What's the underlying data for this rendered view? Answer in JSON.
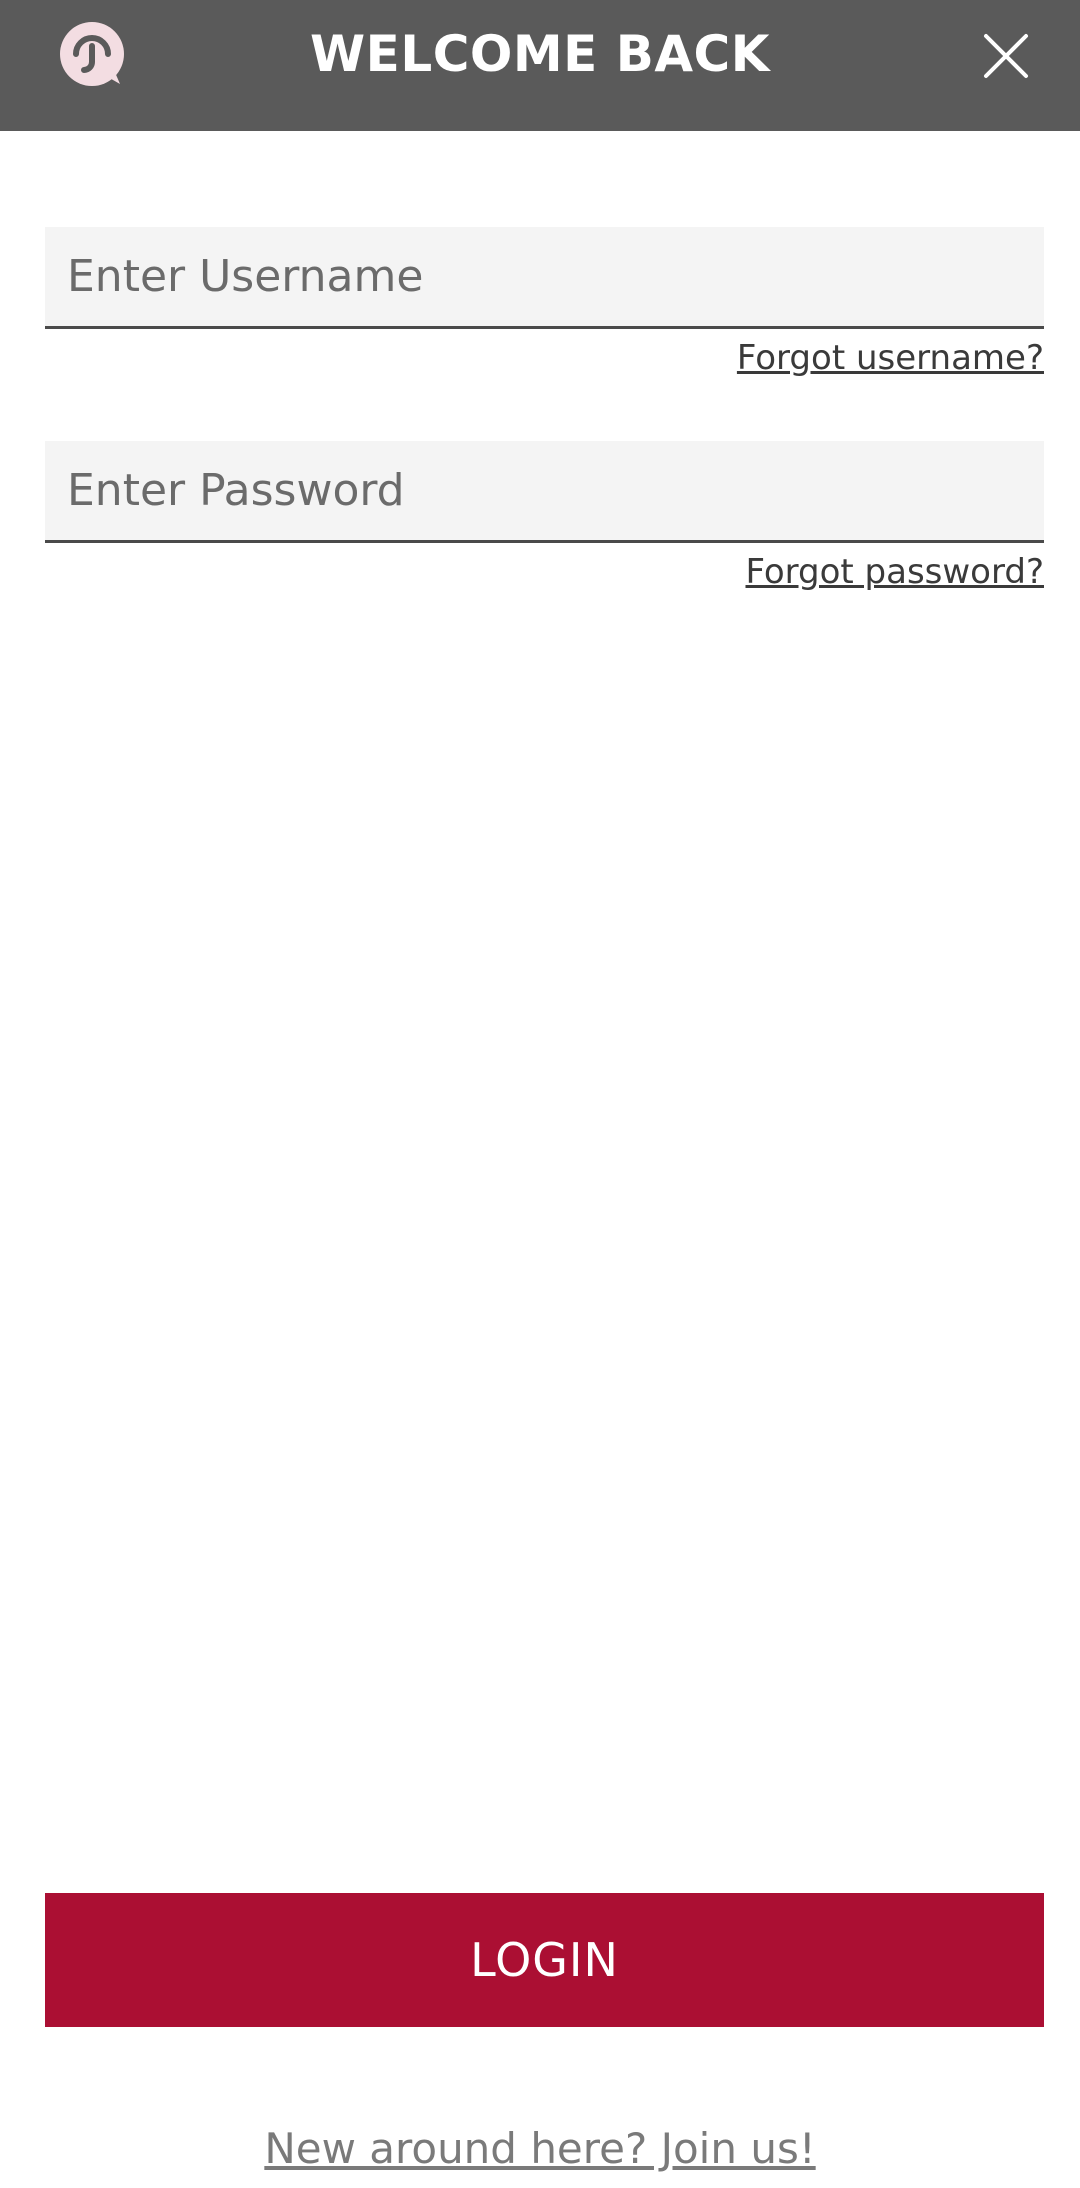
{
  "header": {
    "title": "WELCOME BACK",
    "logo_icon": "chat-bubble-logo-icon",
    "close_icon": "close-icon",
    "background": "#5a5a5a"
  },
  "form": {
    "username": {
      "value": "",
      "placeholder": "Enter Username",
      "forgot_label": "Forgot username?"
    },
    "password": {
      "value": "",
      "placeholder": "Enter Password",
      "forgot_label": "Forgot password?"
    }
  },
  "login_button": {
    "label": "LOGIN",
    "color": "#ab0f33"
  },
  "join_link": {
    "label": "New around here? Join us!"
  }
}
